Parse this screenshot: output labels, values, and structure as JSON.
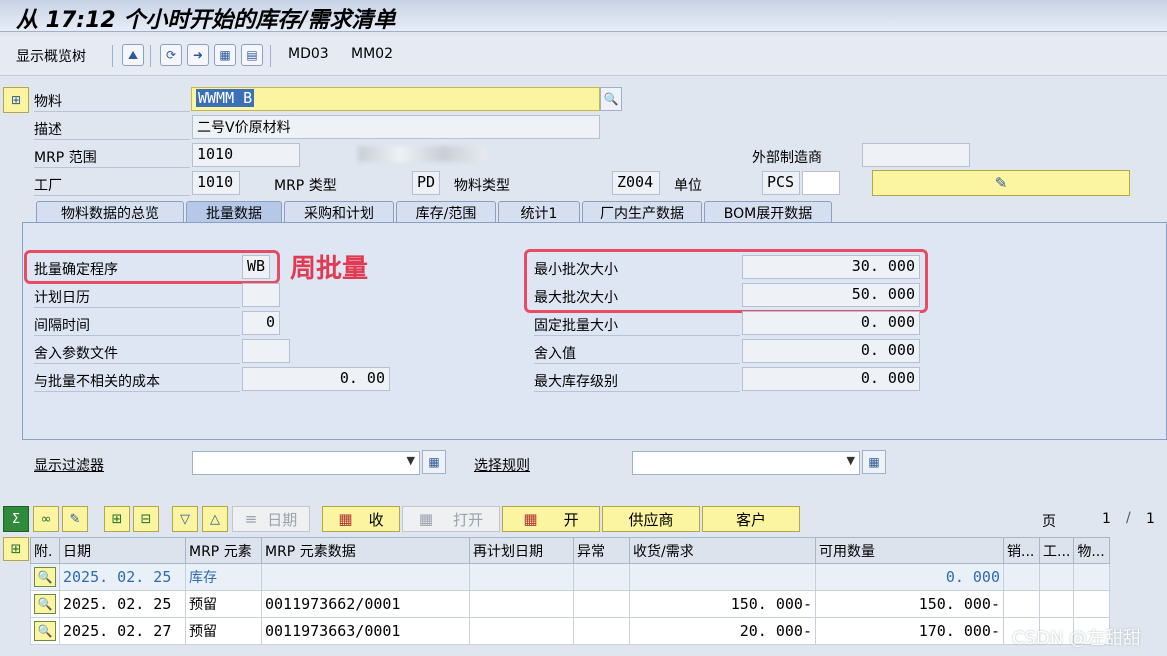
{
  "title": "从 17:12 个小时开始的库存/需求清单",
  "toolbar": {
    "overview_tree": "显示概览树",
    "icons": [
      "person-mountain-icon",
      "refresh-icon",
      "forward-icon",
      "calculator-icon",
      "document-icon"
    ],
    "md03": "MD03",
    "mm02": "MM02"
  },
  "header": {
    "material_label": "物料",
    "material_value": "WWMM B",
    "desc_label": "描述",
    "desc_value": "二号V价原材料",
    "mrp_area_label": "MRP 范围",
    "mrp_area_value": "1010",
    "ext_mfr_label": "外部制造商",
    "ext_mfr_value": "",
    "plant_label": "工厂",
    "plant_value": "1010",
    "mrp_type_label": "MRP 类型",
    "mrp_type_value": "PD",
    "mat_type_label": "物料类型",
    "mat_type_value": "Z004",
    "unit_label": "单位",
    "unit_value": "PCS"
  },
  "tabs": [
    "物料数据的总览",
    "批量数据",
    "采购和计划",
    "库存/范围",
    "统计1",
    "厂内生产数据",
    "BOM展开数据"
  ],
  "lot": {
    "procedure_label": "批量确定程序",
    "procedure_value": "WB",
    "annotation": "周批量",
    "calendar_label": "计划日历",
    "calendar_value": "",
    "interval_label": "间隔时间",
    "interval_value": "0",
    "rounding_profile_label": "舍入参数文件",
    "rounding_profile_value": "",
    "lot_indep_cost_label": "与批量不相关的成本",
    "lot_indep_cost_value": "0. 00",
    "min_lot_label": "最小批次大小",
    "min_lot_value": "30. 000",
    "max_lot_label": "最大批次大小",
    "max_lot_value": "50. 000",
    "fixed_lot_label": "固定批量大小",
    "fixed_lot_value": "0. 000",
    "rounding_value_label": "舍入值",
    "rounding_value_value": "0. 000",
    "max_stock_label": "最大库存级别",
    "max_stock_value": "0. 000"
  },
  "filters": {
    "display_filter_label": "显示过滤器",
    "selection_rule_label": "选择规则"
  },
  "grid_toolbar": {
    "date_btn": "日期",
    "receive_btn": "收",
    "open_btn": "打开",
    "open2_btn": "开",
    "vendor_btn": "供应商",
    "customer_btn": "客户",
    "page_label": "页",
    "page_current": "1",
    "page_sep": "/",
    "page_total": "1"
  },
  "table": {
    "headers": [
      "附.",
      "日期",
      "MRP 元素",
      "MRP 元素数据",
      "再计划日期",
      "异常",
      "收货/需求",
      "可用数量",
      "销...",
      "工...",
      "物..."
    ],
    "rows": [
      {
        "date": "2025. 02. 25",
        "element": "库存",
        "data": "",
        "reschedule": "",
        "exception": "",
        "recv": "",
        "avail": "0. 000"
      },
      {
        "date": "2025. 02. 25",
        "element": "预留",
        "data": "0011973662/0001",
        "reschedule": "",
        "exception": "",
        "recv": "150. 000-",
        "avail": "150. 000-"
      },
      {
        "date": "2025. 02. 27",
        "element": "预留",
        "data": "0011973663/0001",
        "reschedule": "",
        "exception": "",
        "recv": "20. 000-",
        "avail": "170. 000-"
      }
    ]
  },
  "watermark": "CSDN @左甜甜"
}
